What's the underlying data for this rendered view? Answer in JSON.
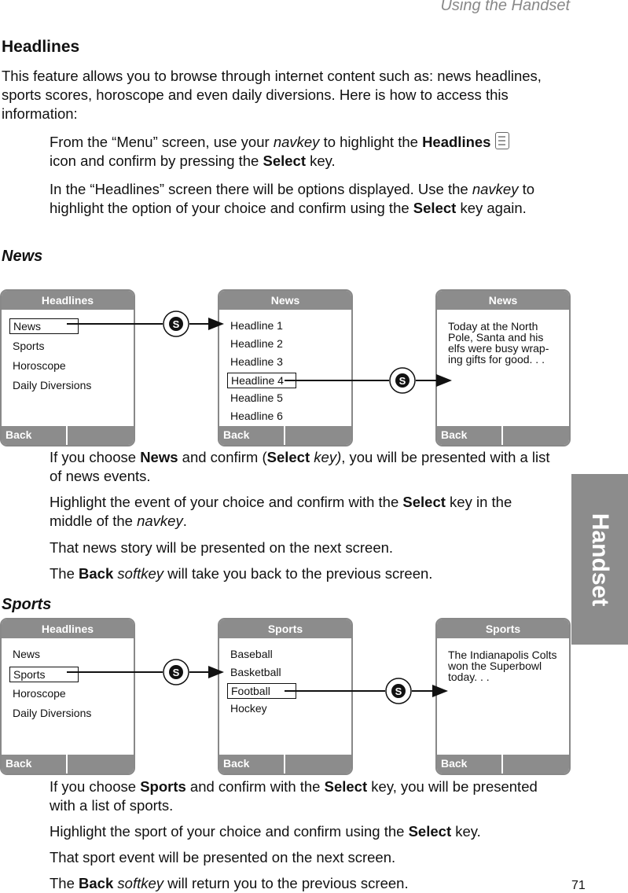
{
  "header": "Using the Handset",
  "title": "Headlines",
  "intro": "This feature allows you to browse through internet content such as: news headlines, sports scores, horoscope and even daily diversions. Here is how to access this information:",
  "step1": {
    "a": "From the “Menu” screen, use your ",
    "navkey": "navkey",
    "b": " to highlight the ",
    "headlines": "Headlines",
    "c": " icon and confirm by pressing the ",
    "select": "Select",
    "d": " key."
  },
  "step2": {
    "a": "In the “Headlines” screen there will be options displayed. Use the ",
    "navkey": "navkey",
    "b": " to highlight the option of your choice and confirm using the ",
    "select": "Select",
    "c": " key again."
  },
  "news_heading": "News",
  "sports_heading": "Sports",
  "back": "Back",
  "news_screens": [
    {
      "title": "Headlines",
      "items": [
        "News",
        "Sports",
        "Horoscope",
        "Daily Diversions"
      ]
    },
    {
      "title": "News",
      "items": [
        "Headline 1",
        "Headline 2",
        "Headline 3",
        "Headline 4",
        "Headline 5",
        "Headline 6"
      ]
    },
    {
      "title": "News",
      "text": "Today at the North Pole, Santa and his elfs were busy wrap-ing gifts for good. . ."
    }
  ],
  "sports_screens": [
    {
      "title": "Headlines",
      "items": [
        "News",
        "Sports",
        "Horoscope",
        "Daily Diversions"
      ]
    },
    {
      "title": "Sports",
      "items": [
        "Baseball",
        "Basketball",
        "Football",
        "Hockey"
      ]
    },
    {
      "title": "Sports",
      "text": "The Indianapolis Colts won the Superbowl today. . ."
    }
  ],
  "select_symbol": "S",
  "news_notes": {
    "n1": {
      "a": "If you choose ",
      "news": "News",
      "b": " and confirm (",
      "select": "Select",
      "key": " key)",
      "c": ", you will be presented with a list of news events."
    },
    "n2": {
      "a": "Highlight the event of your choice and confirm with the ",
      "select": "Select",
      "b": " key in the middle of the ",
      "navkey": "navkey",
      "c": "."
    },
    "n3": "That news story will be presented on the next screen.",
    "n4": {
      "a": "The ",
      "back": "Back",
      "softkey": " softkey",
      "b": " will take you back to the previous screen."
    }
  },
  "sports_notes": {
    "n1": {
      "a": "If you choose ",
      "sports": "Sports",
      "b": " and confirm with the ",
      "select": "Select",
      "c": " key, you will be presented with a list of sports."
    },
    "n2": {
      "a": "Highlight the sport of your choice and confirm using the ",
      "select": "Select",
      "b": " key."
    },
    "n3": "That sport event will be presented on the next screen.",
    "n4": {
      "a": "The ",
      "back": "Back",
      "softkey": " softkey",
      "b": " will return you to the previous screen."
    }
  },
  "side_tab": "Handset",
  "page_number": "71"
}
